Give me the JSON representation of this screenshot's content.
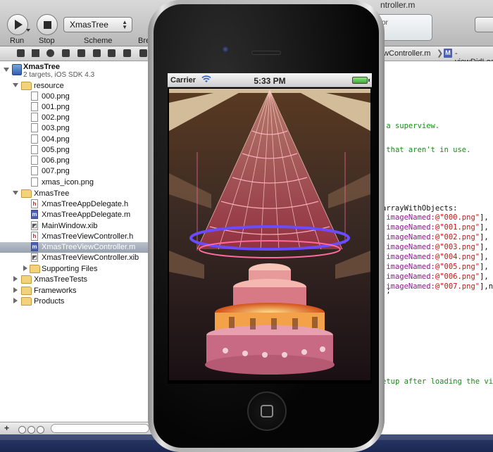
{
  "window": {
    "title_fragment": "ntroller.m"
  },
  "toolbar": {
    "run_label": "Run",
    "stop_label": "Stop",
    "scheme_value": "XmasTree",
    "scheme_label": "Scheme",
    "breakpoints_label": "Bre",
    "activity_text": "itor"
  },
  "navigator": {
    "project": {
      "name": "XmasTree",
      "subtitle": "2 targets, iOS SDK 4.3"
    },
    "groups": {
      "resource": "resource",
      "xmastree": "XmasTree",
      "tests": "XmasTreeTests",
      "frameworks": "Frameworks",
      "products": "Products",
      "supporting": "Supporting Files"
    },
    "resource_files": [
      "000.png",
      "001.png",
      "002.png",
      "003.png",
      "004.png",
      "005.png",
      "006.png",
      "007.png",
      "xmas_icon.png"
    ],
    "source_files": [
      {
        "name": "XmasTreeAppDelegate.h",
        "kind": "h"
      },
      {
        "name": "XmasTreeAppDelegate.m",
        "kind": "m"
      },
      {
        "name": "MainWindow.xib",
        "kind": "xib"
      },
      {
        "name": "XmasTreeViewController.h",
        "kind": "h"
      },
      {
        "name": "XmasTreeViewController.m",
        "kind": "m",
        "selected": true
      },
      {
        "name": "XmasTreeViewController.xib",
        "kind": "xib"
      }
    ]
  },
  "jump_bar": {
    "file": "ewController.m",
    "method": "-viewDidLoa",
    "method_badge": "M"
  },
  "editor": {
    "lines": [
      {
        "text": " a superview.",
        "kind": "comment"
      },
      {
        "text": " that aren't in use.",
        "kind": "comment"
      },
      {
        "text": "arrayWithObjects:",
        "kind": "code"
      },
      {
        "text": " imageNamed:@\"000.png\"],",
        "kind": "code"
      },
      {
        "text": " imageNamed:@\"001.png\"],",
        "kind": "code"
      },
      {
        "text": " imageNamed:@\"002.png\"],",
        "kind": "code"
      },
      {
        "text": " imageNamed:@\"003.png\"],",
        "kind": "code"
      },
      {
        "text": " imageNamed:@\"004.png\"],",
        "kind": "code"
      },
      {
        "text": " imageNamed:@\"005.png\"],",
        "kind": "code"
      },
      {
        "text": " imageNamed:@\"006.png\"],",
        "kind": "code"
      },
      {
        "text": " imageNamed:@\"007.png\"],ni",
        "kind": "code"
      },
      {
        "text": "];",
        "kind": "code"
      },
      {
        "text": "etup after loading the vie",
        "kind": "comment"
      }
    ]
  },
  "simulator": {
    "carrier": "Carrier",
    "time": "5:33 PM"
  },
  "colors": {
    "selection": "#a9b2be",
    "comment_green": "#1a8a1a",
    "string_red": "#c41a16",
    "dock_blue": "#223062"
  }
}
